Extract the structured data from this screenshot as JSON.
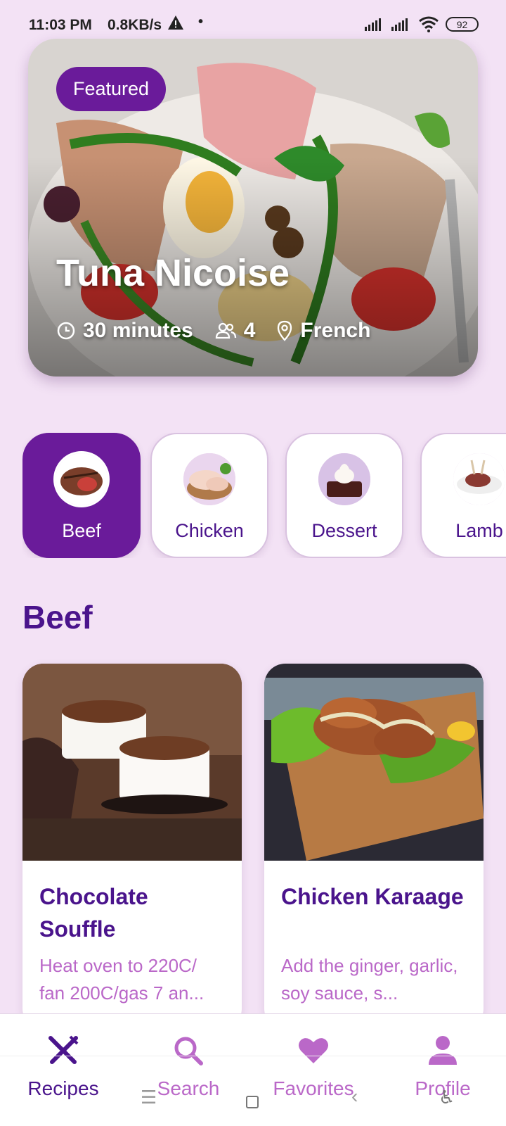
{
  "status_bar": {
    "time": "11:03 PM",
    "net_speed": "0.8KB/s",
    "battery": "92"
  },
  "featured": {
    "badge": "Featured",
    "title": "Tuna Nicoise",
    "duration": "30 minutes",
    "servings": "4",
    "cuisine": "French"
  },
  "categories": [
    {
      "label": "Beef",
      "active": true
    },
    {
      "label": "Chicken",
      "active": false
    },
    {
      "label": "Dessert",
      "active": false
    },
    {
      "label": "Lamb",
      "active": false
    }
  ],
  "section": {
    "title": "Beef"
  },
  "recipes": [
    {
      "title": "Chocolate Souffle",
      "description": "Heat oven to 220C/ fan 200C/gas 7 an..."
    },
    {
      "title": "Chicken Karaage",
      "description": "Add the ginger, garlic, soy sauce, s..."
    }
  ],
  "bottom_nav": [
    {
      "label": "Recipes",
      "icon": "fork-knife-icon",
      "active": true
    },
    {
      "label": "Search",
      "icon": "search-icon",
      "active": false
    },
    {
      "label": "Favorites",
      "icon": "heart-icon",
      "active": false
    },
    {
      "label": "Profile",
      "icon": "person-icon",
      "active": false
    }
  ],
  "colors": {
    "background": "#f3e2f5",
    "primary": "#6a1b9a",
    "primary_text": "#4a148c",
    "accent_text": "#ba68c8"
  }
}
